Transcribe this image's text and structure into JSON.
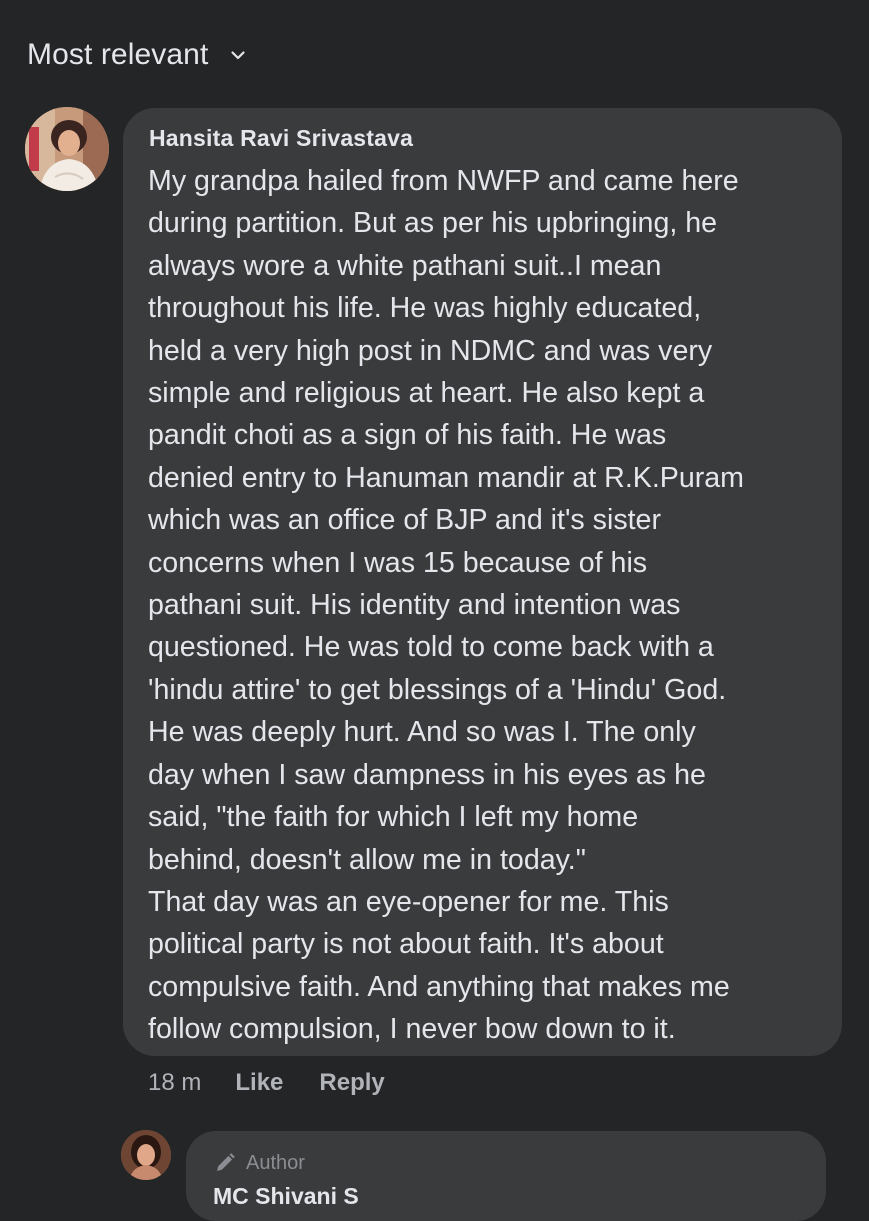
{
  "sort": {
    "label": "Most relevant",
    "icon": "chevron-down-icon"
  },
  "comment": {
    "author": "Hansita Ravi Srivastava",
    "avatar": "profile-photo-avatar",
    "lines": [
      "My grandpa hailed from NWFP and came here",
      "during partition. But as per his upbringing, he",
      "always wore a white pathani suit..I mean",
      "throughout his life. He was highly educated,",
      "held a very high post in NDMC and was very",
      "simple and religious at heart. He also kept a",
      "pandit choti as a sign of his faith. He was",
      "denied entry to Hanuman mandir at R.K.Puram",
      "which was an office of BJP and it's sister",
      "concerns when I was 15 because of his",
      "pathani suit. His identity and intention was",
      "questioned. He was told to come back with a",
      "'hindu attire' to get blessings of a 'Hindu' God.",
      "He was deeply hurt. And so was I. The only",
      "day when I saw dampness in his eyes as he",
      "said, \"the faith for which I left my home",
      "behind, doesn't allow me in today.\"",
      "That day was an eye-opener for me. This",
      "political party is not about faith. It's about",
      "compulsive faith. And anything that makes me",
      "follow compulsion, I never bow down to it."
    ],
    "timestamp": "18 m",
    "like_label": "Like",
    "reply_label": "Reply"
  },
  "reply": {
    "badge_icon": "pencil-icon",
    "badge_label": "Author",
    "author": "MC Shivani S"
  },
  "colors": {
    "background": "#242526",
    "bubble": "#3a3b3c",
    "primary_text": "#e4e6eb",
    "secondary_text": "#b0b3b8"
  }
}
